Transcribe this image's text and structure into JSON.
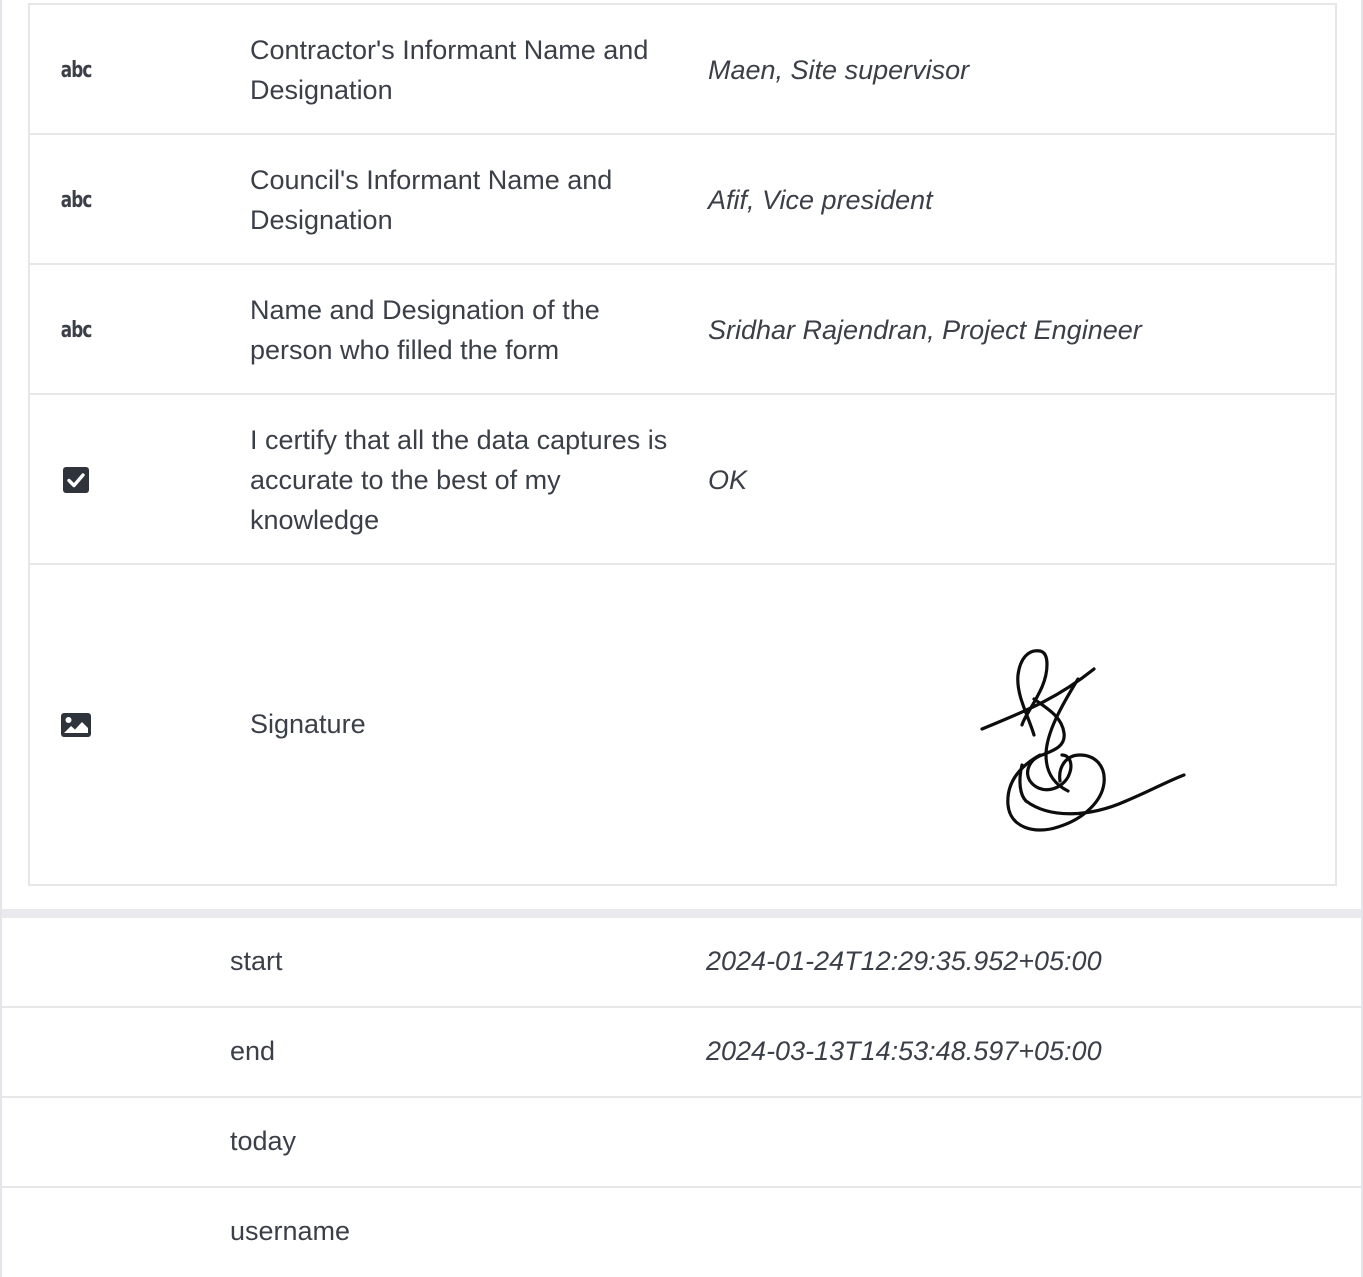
{
  "form_rows": [
    {
      "icon": "text-type-icon",
      "icon_text": "abc",
      "label": "Contractor's Informant Name and Designation",
      "value": "Maen, Site supervisor"
    },
    {
      "icon": "text-type-icon",
      "icon_text": "abc",
      "label": "Council's Informant Name and Designation",
      "value": "Afif, Vice president"
    },
    {
      "icon": "text-type-icon",
      "icon_text": "abc",
      "label": "Name and Designation of the person who filled the form",
      "value": "Sridhar Rajendran, Project Engineer"
    },
    {
      "icon": "checkbox-icon",
      "label": "I certify that all the data captures is accurate to the best of my knowledge",
      "value": "OK"
    },
    {
      "icon": "image-icon",
      "label": "Signature",
      "value_type": "signature-image"
    }
  ],
  "meta_rows": [
    {
      "label": "start",
      "value": "2024-01-24T12:29:35.952+05:00"
    },
    {
      "label": "end",
      "value": "2024-03-13T14:53:48.597+05:00"
    },
    {
      "label": "today",
      "value": ""
    },
    {
      "label": "username",
      "value": ""
    }
  ],
  "colors": {
    "text": "#3b3f48",
    "border": "#e7e7ea",
    "separator": "#e9e9ee",
    "background": "#ffffff"
  }
}
